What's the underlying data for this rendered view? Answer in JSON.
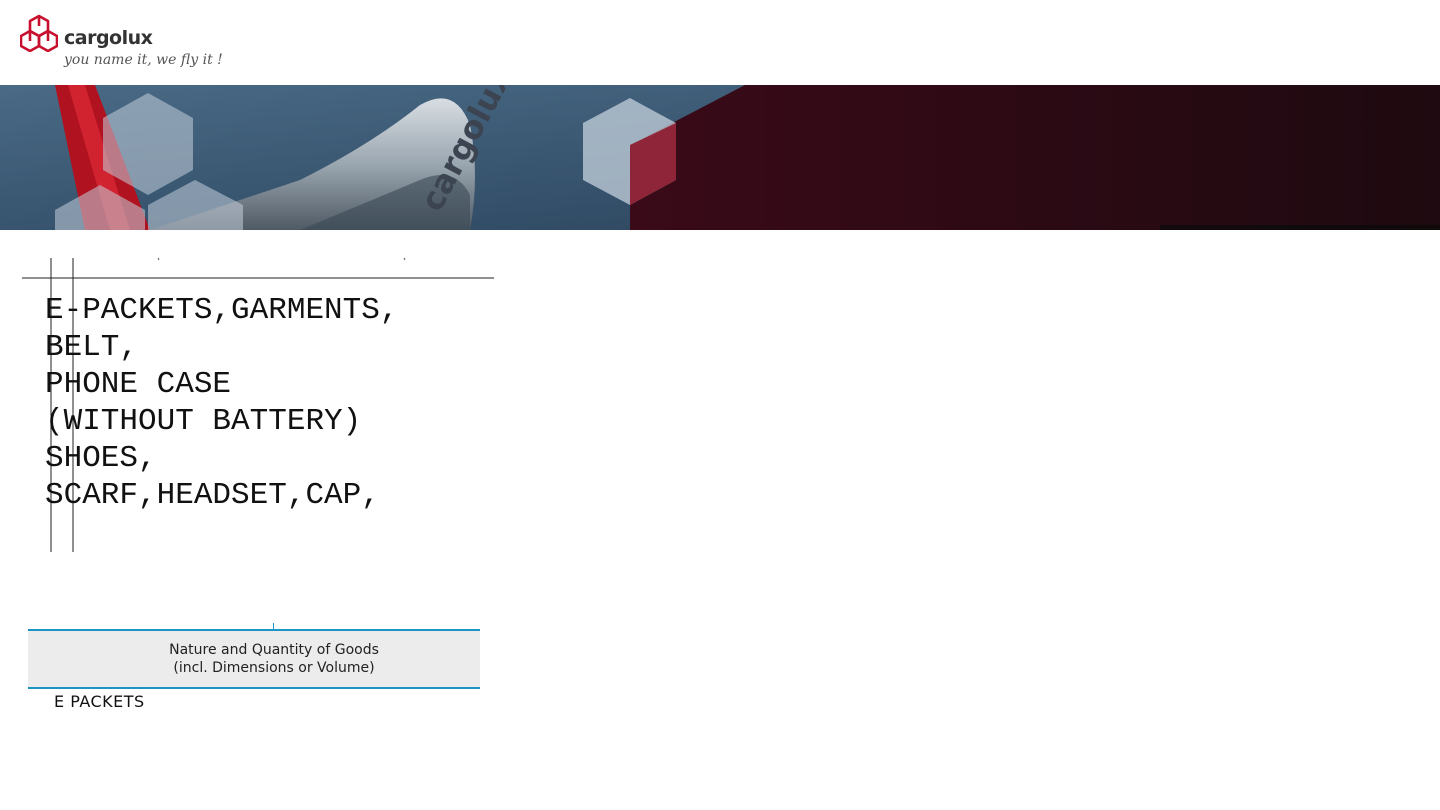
{
  "header": {
    "brand": "cargolux",
    "tagline": "you name it, we fly it !"
  },
  "banner": {
    "fuselage_text": "cargolux",
    "icons": [
      "hexagon-pattern"
    ],
    "colors": {
      "sky": "#3d5870",
      "dark_panel": "#2a0612",
      "accent_red": "#c8102e",
      "hex_tint": "#9fb2c4"
    }
  },
  "document": {
    "goods_lines": [
      "E-PACKETS,GARMENTS,",
      "BELT,",
      "PHONE CASE",
      "(WITHOUT BATTERY)",
      "SHOES,",
      "SCARF,HEADSET,CAP,"
    ]
  },
  "field": {
    "label_line1": "Nature and Quantity of Goods",
    "label_line2": "(incl. Dimensions or Volume)",
    "value": "E PACKETS",
    "accent_color": "#1a95c4"
  }
}
